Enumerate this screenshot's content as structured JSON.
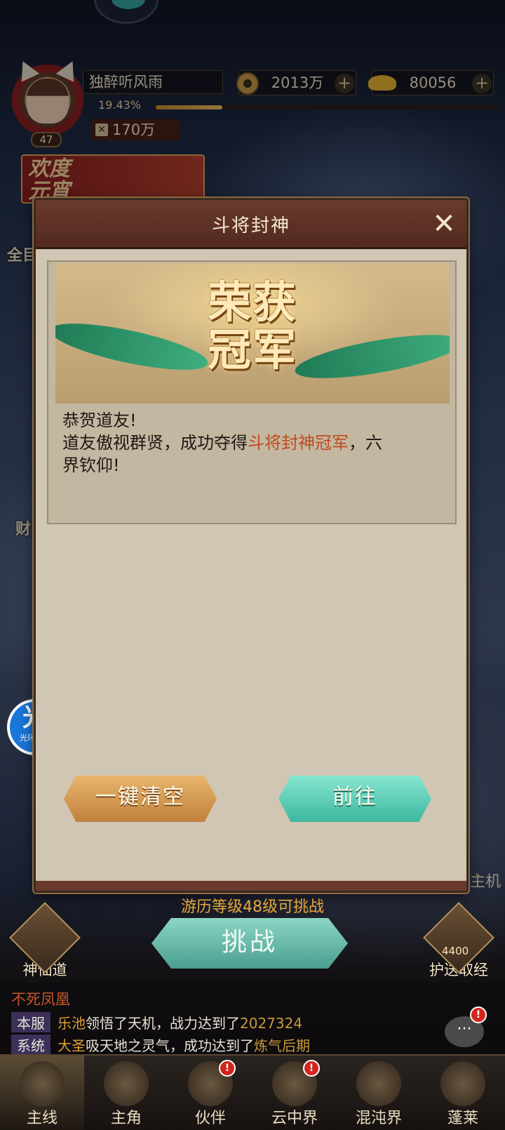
{
  "player": {
    "name": "独醉听风雨",
    "level": "47",
    "exp_percent_text": "19.43%",
    "exp_fraction": 0.1943,
    "power": "170万"
  },
  "resources": {
    "copper": "2013万",
    "gold": "80056",
    "plus": "+"
  },
  "event_banner": {
    "line1": "欢度",
    "line2": "元宵"
  },
  "side_peeks": {
    "left_top": "全目",
    "left_bottom": "财",
    "machine": "主机"
  },
  "modal": {
    "title": "斗将封神",
    "close": "✕",
    "banner_line1": "荣获",
    "banner_line2": "冠军",
    "body_line1": "恭贺道友!",
    "body_line2_prefix": "道友傲视群贤，成功夺得",
    "body_line2_highlight": "斗将封神冠军",
    "body_line2_suffix": "，六",
    "body_line3": "界钦仰!",
    "clear_button": "一键清空",
    "go_button": "前往"
  },
  "assistant": {
    "glyph": "光",
    "label": "光环助手"
  },
  "challenge": {
    "hint": "游历等级48级可挑战",
    "button": "挑战",
    "left_label": "神仙道",
    "right_label": "护送取经",
    "right_count": "4400"
  },
  "chat": {
    "title": "不死凤凰",
    "line1": {
      "tag": "本服",
      "who": "乐池",
      "text": "领悟了天机，战力达到了",
      "num": "2027324"
    },
    "line2": {
      "tag": "系统",
      "who": "大圣",
      "text": "吸天地之灵气，成功达到了",
      "num": "炼气后期"
    },
    "button": "···",
    "badge": "!"
  },
  "nav": [
    {
      "label": "主线"
    },
    {
      "label": "主角"
    },
    {
      "label": "伙伴",
      "badge": "!"
    },
    {
      "label": "云中界",
      "badge": "!"
    },
    {
      "label": "混沌界"
    },
    {
      "label": "蓬莱"
    }
  ],
  "colors": {
    "highlight": "#c04a1e",
    "go_button": "#3eb7a0",
    "clear_button": "#c1813c"
  }
}
